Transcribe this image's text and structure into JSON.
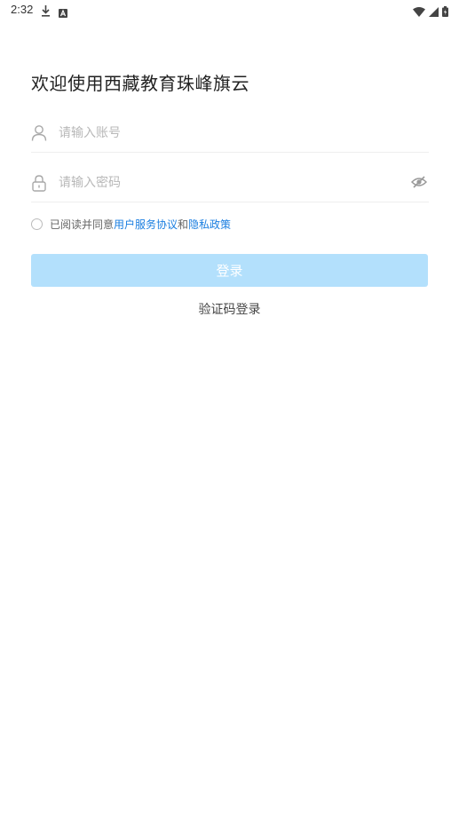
{
  "status_bar": {
    "time": "2:32",
    "icons": [
      "download-icon",
      "a-badge-icon",
      "wifi-icon",
      "cell-signal-icon",
      "battery-icon"
    ]
  },
  "title": "欢迎使用西藏教育珠峰旗云",
  "account": {
    "icon": "user-icon",
    "placeholder": "请输入账号",
    "value": ""
  },
  "password": {
    "icon": "lock-icon",
    "placeholder": "请输入密码",
    "value": "",
    "toggle_icon": "eye-off-icon"
  },
  "agreement": {
    "prefix": "已阅读并同意",
    "user_agreement": "用户服务协议",
    "conjunction": "和",
    "privacy_policy": "隐私政策"
  },
  "login_button": "登录",
  "sms_login": "验证码登录",
  "colors": {
    "accent": "#1a7ee0",
    "login_button_bg": "#b3e0fc",
    "placeholder": "#b8b8b8"
  }
}
